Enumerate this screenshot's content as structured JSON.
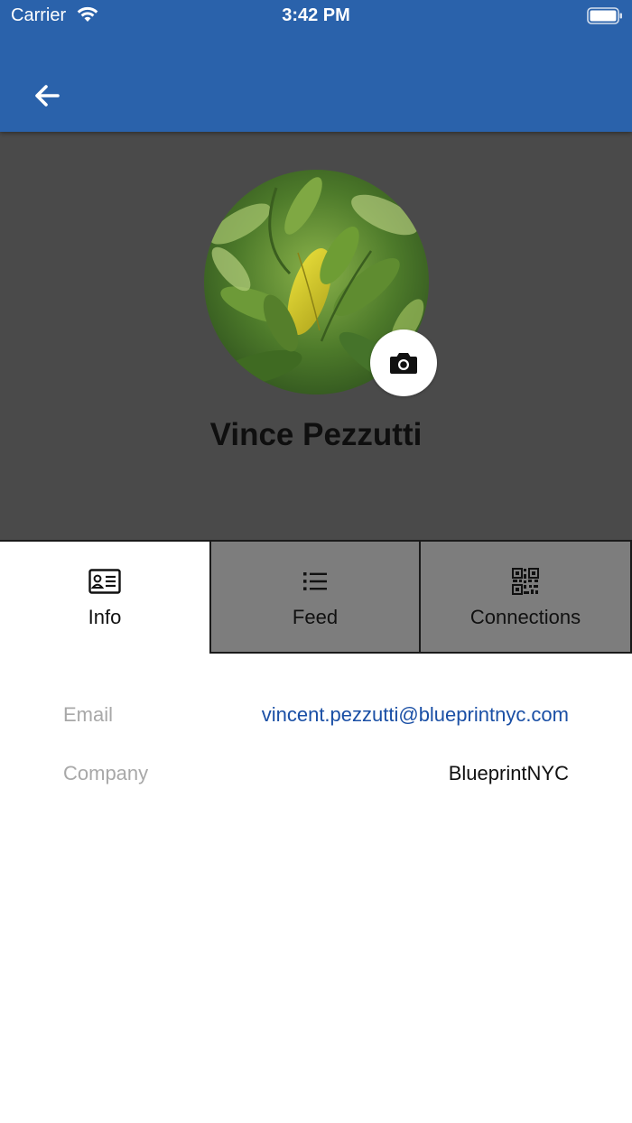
{
  "status_bar": {
    "carrier": "Carrier",
    "time": "3:42 PM",
    "wifi_icon": "wifi-icon",
    "battery_icon": "battery-icon"
  },
  "app_bar": {
    "color": "#2a62ab",
    "back_icon": "arrow-left-icon"
  },
  "profile": {
    "name": "Vince Pezzutti",
    "avatar_description": "leaf-photo",
    "camera_icon": "camera-icon",
    "header_color": "#4a4a4a"
  },
  "tabs": [
    {
      "label": "Info",
      "icon": "id-card-icon",
      "selected": true
    },
    {
      "label": "Feed",
      "icon": "list-icon",
      "selected": false
    },
    {
      "label": "Connections",
      "icon": "qr-code-icon",
      "selected": false
    }
  ],
  "info": {
    "email_label": "Email",
    "email_value": "vincent.pezzutti@blueprintnyc.com",
    "company_label": "Company",
    "company_value": "BlueprintNYC"
  },
  "colors": {
    "link": "#1a4fa5",
    "label": "#a8a8a8",
    "tab_inactive": "#7d7d7d"
  }
}
